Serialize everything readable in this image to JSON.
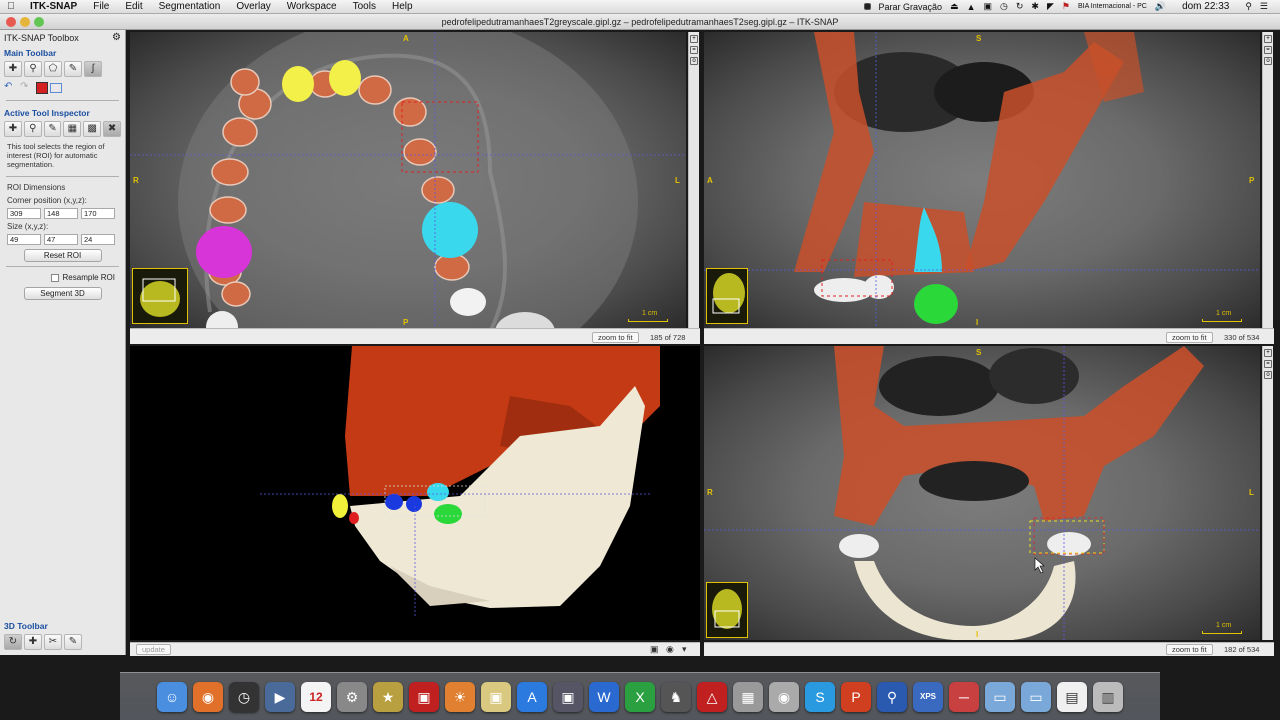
{
  "menubar": {
    "app": "ITK-SNAP",
    "items": [
      "File",
      "Edit",
      "Segmentation",
      "Overlay",
      "Workspace",
      "Tools",
      "Help"
    ],
    "record": "Parar Gravação",
    "input_source": "BIA Internacional - PC",
    "clock": "dom 22:33"
  },
  "window": {
    "title": "pedrofelipedutramanhaesT2greyscale.gipl.gz – pedrofelipedutramanhaesT2seg.gipl.gz – ITK-SNAP"
  },
  "sidebar": {
    "title": "ITK-SNAP Toolbox",
    "main_toolbar": "Main Toolbar",
    "active_tool_inspector": "Active Tool Inspector",
    "help_text": "This tool selects the region of interest (ROI) for automatic segmentation.",
    "roi_dimensions": "ROI Dimensions",
    "corner_label": "Corner position (x,y,z):",
    "corner": [
      "309",
      "148",
      "170"
    ],
    "size_label": "Size (x,y,z):",
    "size": [
      "49",
      "47",
      "24"
    ],
    "reset_roi": "Reset ROI",
    "resample_roi": "Resample ROI",
    "segment_3d": "Segment 3D",
    "toolbar_3d": "3D Toolbar",
    "update": "update"
  },
  "views": {
    "axial": {
      "top": "A",
      "bottom": "P",
      "left": "R",
      "right": "L",
      "scale": "1 cm",
      "zoom": "zoom to fit",
      "slice": "185 of 728"
    },
    "sagittal": {
      "top": "S",
      "bottom": "I",
      "left": "A",
      "right": "P",
      "scale": "1 cm",
      "zoom": "zoom to fit",
      "slice": "330 of 534"
    },
    "coronal": {
      "top": "S",
      "bottom": "I",
      "left": "R",
      "right": "L",
      "scale": "1 cm",
      "zoom": "zoom to fit",
      "slice": "182 of 534"
    }
  },
  "colors": {
    "bone": "#c8502a",
    "cyan": "#29e0f0",
    "yellow": "#f2f03a",
    "magenta": "#e030e0",
    "green": "#2ad83a",
    "roi": "#e02020",
    "orientation": "#e3c200"
  },
  "dock": {
    "icons": [
      "finder-icon",
      "firefox-icon",
      "dashboard-icon",
      "quicktime-icon",
      "calendar-icon",
      "system-preferences-icon",
      "imovie-icon",
      "photo-booth-icon",
      "preview-icon",
      "app-store-icon",
      "remote-desktop-icon",
      "word-icon",
      "excel-icon",
      "chess-icon",
      "acrobat-icon",
      "calculator-icon",
      "disk-utility-icon",
      "utility-icon",
      "skype-icon",
      "powerpoint-icon",
      "quicktime-x-icon",
      "xps-viewer-icon",
      "cable-icon",
      "folder-icon",
      "folder-icon",
      "document-icon",
      "trash-icon"
    ],
    "calendar_day": "12",
    "xps_label": "XPS"
  }
}
